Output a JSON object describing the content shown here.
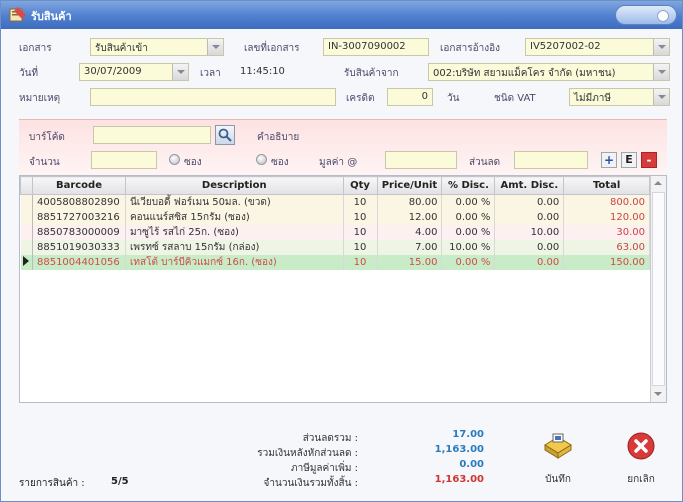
{
  "window": {
    "title": "รับสินค้า"
  },
  "form": {
    "doc_type_label": "เอกสาร",
    "doc_type_value": "รับสินค้าเข้า",
    "doc_no_label": "เลขที่เอกสาร",
    "doc_no_value": "IN-3007090002",
    "ref_doc_label": "เอกสารอ้างอิง",
    "ref_doc_value": "IV5207002-02",
    "date_label": "วันที่",
    "date_value": "30/07/2009",
    "time_label": "เวลา",
    "time_value": "11:45:10",
    "received_from_label": "รับสินค้าจาก",
    "received_from_value": "002:บริษัท สยามแม็คโคร จำกัด (มหาชน)",
    "note_label": "หมายเหตุ",
    "note_value": "",
    "credit_label": "เครดิต",
    "credit_value": "0",
    "credit_unit": "วัน",
    "vat_label": "ชนิด VAT",
    "vat_value": "ไม่มีภาษี"
  },
  "entry": {
    "barcode_label": "บาร์โค้ด",
    "description_label": "คำอธิบาย",
    "qty_label": "จำนวน",
    "unit_option_1": "ซอง",
    "unit_option_2": "ซอง",
    "unit_price_label": "มูลค่า @",
    "discount_label": "ส่วนลด",
    "add_btn": "+",
    "edit_btn": "E",
    "remove_btn": "-"
  },
  "grid": {
    "columns": [
      "Barcode",
      "Description",
      "Qty",
      "Price/Unit",
      "% Disc.",
      "Amt. Disc.",
      "Total"
    ],
    "rows": [
      {
        "barcode": "4005808802890",
        "description": "นีเวียบอดี้ ฟอร์เมน 50มล. (ขวด)",
        "qty": "10",
        "price": "80.00",
        "disc_pct": "0.00 %",
        "disc_amt": "0.00",
        "total": "800.00"
      },
      {
        "barcode": "8851727003216",
        "description": "คอนแนร์สซิส 15กรัม (ซอง)",
        "qty": "10",
        "price": "12.00",
        "disc_pct": "0.00 %",
        "disc_amt": "0.00",
        "total": "120.00"
      },
      {
        "barcode": "8850783000009",
        "description": "มาซูไร้ รสไก่ 25ก. (ซอง)",
        "qty": "10",
        "price": "4.00",
        "disc_pct": "0.00 %",
        "disc_amt": "10.00",
        "total": "30.00"
      },
      {
        "barcode": "8851019030333",
        "description": "เพรทซ์ รสลาบ 15กรัม (กล่อง)",
        "qty": "10",
        "price": "7.00",
        "disc_pct": "10.00 %",
        "disc_amt": "0.00",
        "total": "63.00"
      },
      {
        "barcode": "8851004401056",
        "description": "เทสโต้ บาร์บีคิวแมกซ์ 16ก. (ซอง)",
        "qty": "10",
        "price": "15.00",
        "disc_pct": "0.00 %",
        "disc_amt": "0.00",
        "total": "150.00"
      }
    ]
  },
  "summary": {
    "total_discount_label": "ส่วนลดรวม :",
    "total_discount_value": "17.00",
    "after_discount_label": "รวมเงินหลังหักส่วนลด :",
    "after_discount_value": "1,163.00",
    "vat_label": "ภาษีมูลค่าเพิ่ม :",
    "vat_value": "0.00",
    "grand_total_label": "จำนวนเงินรวมทั้งสิ้น :",
    "grand_total_value": "1,163.00",
    "item_count_label": "รายการสินค้า :",
    "item_count_value": "5/5"
  },
  "actions": {
    "save_label": "บันทึก",
    "cancel_label": "ยกเลิก"
  },
  "colors": {
    "titlebar": "#4f7fcf",
    "field_bg": "#fbfbd9",
    "total_red": "#c44",
    "value_blue": "#2a7bbd"
  }
}
